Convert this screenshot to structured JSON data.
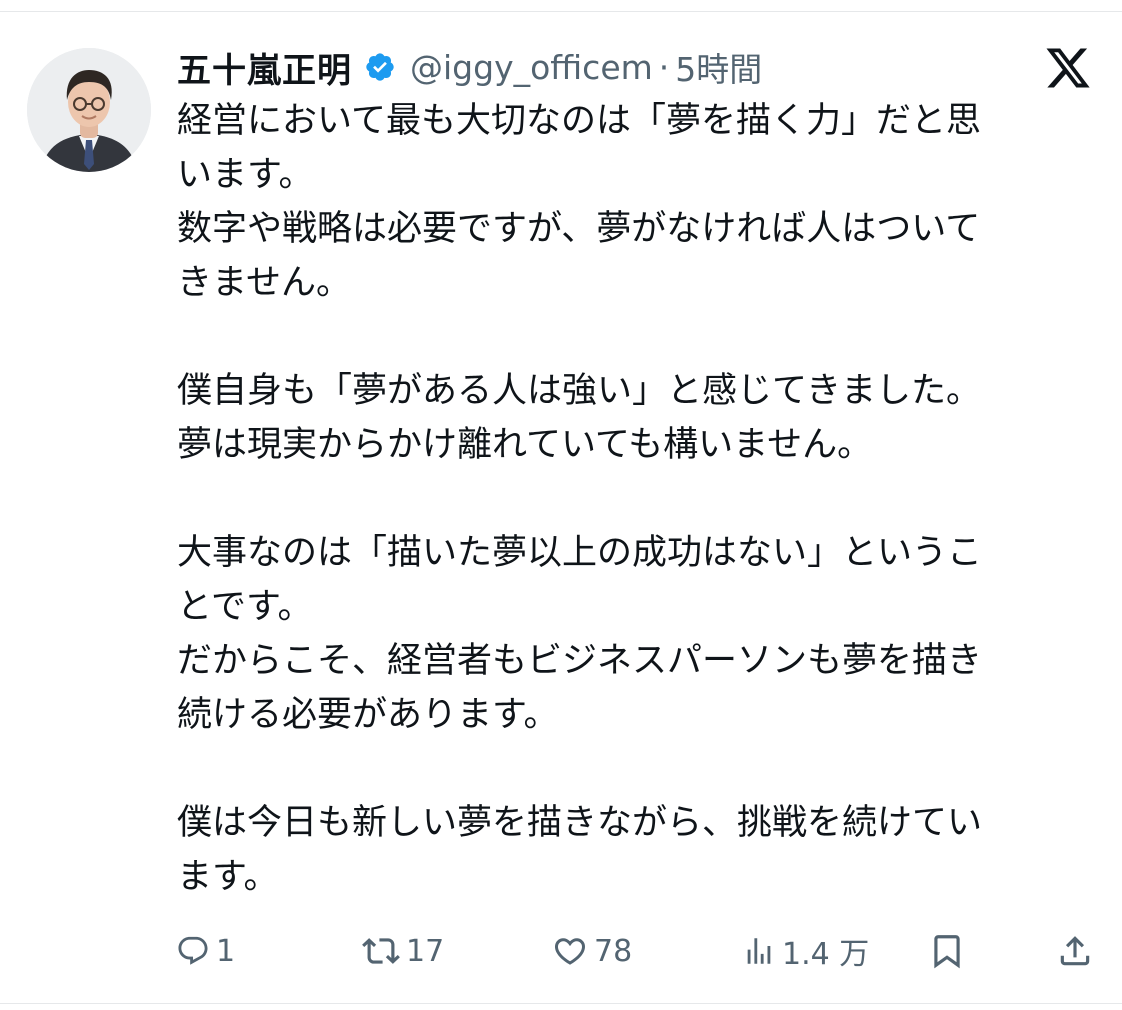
{
  "post": {
    "author": {
      "display_name": "五十嵐正明",
      "verified": true,
      "handle": "@iggy_officem",
      "separator": "·",
      "time": "5時間",
      "avatar_icon": "profile-photo"
    },
    "platform_icon": "x-logo-icon",
    "body_lines": [
      "経営において最も大切なのは「夢を描く力」だと思",
      "います。",
      "数字や戦略は必要ですが、夢がなければ人はついて",
      "きません。",
      "",
      "僕自身も「夢がある人は強い」と感じてきました。",
      "夢は現実からかけ離れていても構いません。",
      "",
      "大事なのは「描いた夢以上の成功はない」というこ",
      "とです。",
      "だからこそ、経営者もビジネスパーソンも夢を描き",
      "続ける必要があります。",
      "",
      "僕は今日も新しい夢を描きながら、挑戦を続けてい",
      "ます。"
    ],
    "actions": {
      "reply": {
        "icon": "reply-icon",
        "count": "1"
      },
      "repost": {
        "icon": "repost-icon",
        "count": "17"
      },
      "like": {
        "icon": "heart-icon",
        "count": "78"
      },
      "views": {
        "icon": "views-icon",
        "count": "1.4 万"
      },
      "bookmark": {
        "icon": "bookmark-icon"
      },
      "share": {
        "icon": "share-icon"
      }
    }
  },
  "colors": {
    "text_primary": "#0f1419",
    "text_secondary": "#536471",
    "verified_blue": "#1d9bf0",
    "divider": "#e6e8ea"
  }
}
